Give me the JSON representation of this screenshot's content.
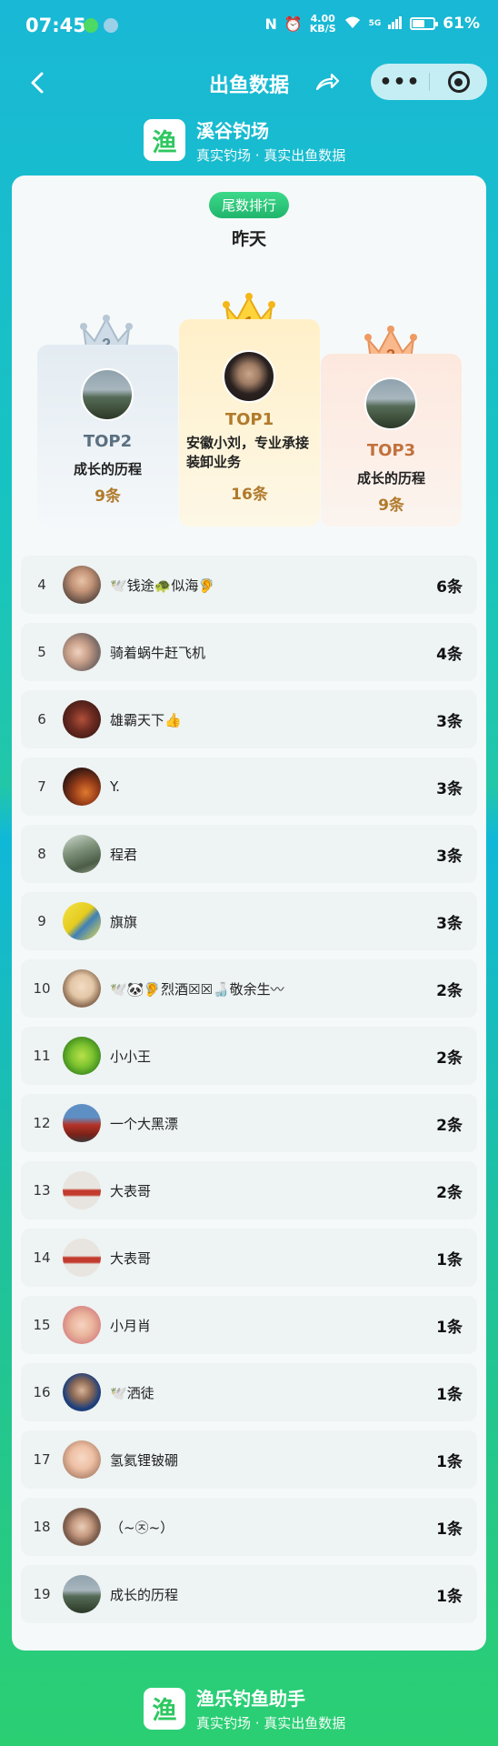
{
  "status_bar": {
    "time": "07:45",
    "network_speed": "4.00",
    "network_unit": "KB/S",
    "signal_label": "5G",
    "battery_percent": "61%",
    "battery_level": 0.61,
    "icons": [
      "wechat-icon",
      "app-icon",
      "nfc-icon",
      "alarm-icon",
      "wifi-icon",
      "signal-icon",
      "battery-icon"
    ]
  },
  "nav": {
    "title": "出鱼数据",
    "more_label": "•••",
    "icons": [
      "back-arrow-icon",
      "share-icon",
      "more-icon",
      "target-icon"
    ]
  },
  "brand": {
    "logo_char": "渔",
    "name": "溪谷钓场",
    "subtitle": "真实钓场 · 真实出鱼数据"
  },
  "ranking": {
    "tag": "尾数排行",
    "day": "昨天",
    "podium": [
      {
        "place": "2",
        "label": "TOP2",
        "name": "成长的历程",
        "count": "9条"
      },
      {
        "place": "1",
        "label": "TOP1",
        "name": "安徽小刘，专业承接装卸业务",
        "count": "16条"
      },
      {
        "place": "3",
        "label": "TOP3",
        "name": "成长的历程",
        "count": "9条"
      }
    ],
    "rows": [
      {
        "rank": "4",
        "name": "🕊️钱途🐢似海🦻",
        "count": "6条"
      },
      {
        "rank": "5",
        "name": "骑着蜗牛赶飞机",
        "count": "4条"
      },
      {
        "rank": "6",
        "name": "雄霸天下👍",
        "count": "3条"
      },
      {
        "rank": "7",
        "name": "Y.",
        "count": "3条"
      },
      {
        "rank": "8",
        "name": "程君",
        "count": "3条"
      },
      {
        "rank": "9",
        "name": "旗旗",
        "count": "3条"
      },
      {
        "rank": "10",
        "name": "🕊️🐼🦻烈酒☒☒🍶敬余生〰",
        "count": "2条"
      },
      {
        "rank": "11",
        "name": "小小王",
        "count": "2条"
      },
      {
        "rank": "12",
        "name": "一个大黑漂",
        "count": "2条"
      },
      {
        "rank": "13",
        "name": "大表哥",
        "count": "2条"
      },
      {
        "rank": "14",
        "name": "大表哥",
        "count": "1条"
      },
      {
        "rank": "15",
        "name": "小月肖",
        "count": "1条"
      },
      {
        "rank": "16",
        "name": "🕊️洒徒",
        "count": "1条"
      },
      {
        "rank": "17",
        "name": "氢氦锂铍硼",
        "count": "1条"
      },
      {
        "rank": "18",
        "name": "（~㉨~）",
        "count": "1条"
      },
      {
        "rank": "19",
        "name": "成长的历程",
        "count": "1条"
      }
    ]
  },
  "footer": {
    "logo_char": "渔",
    "name": "渔乐钓鱼助手",
    "subtitle": "真实钓场 · 真实出鱼数据"
  },
  "colors": {
    "accent_green": "#2ec760",
    "gold": "#b07a2b",
    "top1_text": "#b07a2b",
    "top2_text": "#5a6f80",
    "top3_text": "#c2713d"
  }
}
